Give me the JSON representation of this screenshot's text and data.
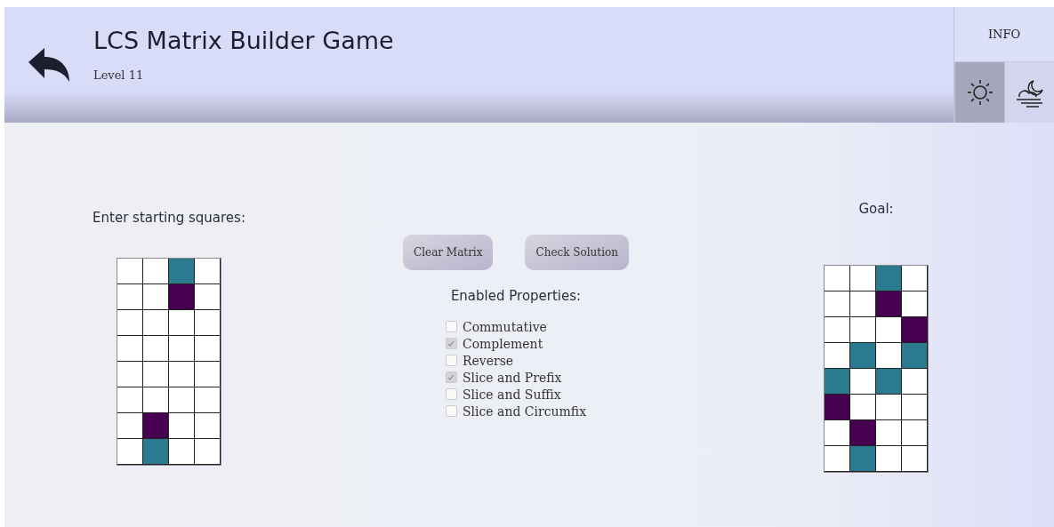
{
  "header": {
    "title": "LCS Matrix Builder Game",
    "subtitle": "Level 11",
    "info": "INFO",
    "themes": [
      {
        "kind": "light",
        "selected": true
      },
      {
        "kind": "dark",
        "selected": false
      }
    ]
  },
  "start": {
    "label": "Enter starting squares:",
    "rows": [
      [
        {
          "color": "#ffffff"
        },
        {
          "color": "#ffffff"
        },
        {
          "color": "#2b7a8f"
        },
        {
          "color": "#ffffff"
        }
      ],
      [
        {
          "color": "#ffffff"
        },
        {
          "color": "#ffffff"
        },
        {
          "color": "#45004f"
        },
        {
          "color": "#ffffff"
        }
      ],
      [
        {
          "color": "#ffffff"
        },
        {
          "color": "#ffffff"
        },
        {
          "color": "#ffffff"
        },
        {
          "color": "#ffffff"
        }
      ],
      [
        {
          "color": "#ffffff"
        },
        {
          "color": "#ffffff"
        },
        {
          "color": "#ffffff"
        },
        {
          "color": "#ffffff"
        }
      ],
      [
        {
          "color": "#ffffff"
        },
        {
          "color": "#ffffff"
        },
        {
          "color": "#ffffff"
        },
        {
          "color": "#ffffff"
        }
      ],
      [
        {
          "color": "#ffffff"
        },
        {
          "color": "#ffffff"
        },
        {
          "color": "#ffffff"
        },
        {
          "color": "#ffffff"
        }
      ],
      [
        {
          "color": "#ffffff"
        },
        {
          "color": "#45004f"
        },
        {
          "color": "#ffffff"
        },
        {
          "color": "#ffffff"
        }
      ],
      [
        {
          "color": "#ffffff"
        },
        {
          "color": "#2b7a8f"
        },
        {
          "color": "#ffffff"
        },
        {
          "color": "#ffffff"
        }
      ]
    ]
  },
  "buttons": [
    "Clear Matrix",
    "Check Solution"
  ],
  "properties": {
    "label": "Enabled Properties:",
    "items": [
      {
        "label": "Commutative",
        "checked": false
      },
      {
        "label": "Complement",
        "checked": true
      },
      {
        "label": "Reverse",
        "checked": false
      },
      {
        "label": "Slice and Prefix",
        "checked": true
      },
      {
        "label": "Slice and Suffix",
        "checked": false
      },
      {
        "label": "Slice and Circumfix",
        "checked": false
      }
    ]
  },
  "goal": {
    "label": "Goal:",
    "rows": [
      [
        {
          "color": "#ffffff"
        },
        {
          "color": "#ffffff"
        },
        {
          "color": "#2b7a8f"
        },
        {
          "color": "#ffffff"
        }
      ],
      [
        {
          "color": "#ffffff"
        },
        {
          "color": "#ffffff"
        },
        {
          "color": "#45004f"
        },
        {
          "color": "#ffffff"
        }
      ],
      [
        {
          "color": "#ffffff"
        },
        {
          "color": "#ffffff"
        },
        {
          "color": "#ffffff"
        },
        {
          "color": "#45004f"
        }
      ],
      [
        {
          "color": "#ffffff"
        },
        {
          "color": "#2b7a8f"
        },
        {
          "color": "#ffffff"
        },
        {
          "color": "#2b7a8f"
        }
      ],
      [
        {
          "color": "#2b7a8f"
        },
        {
          "color": "#ffffff"
        },
        {
          "color": "#2b7a8f"
        },
        {
          "color": "#ffffff"
        }
      ],
      [
        {
          "color": "#45004f"
        },
        {
          "color": "#ffffff"
        },
        {
          "color": "#ffffff"
        },
        {
          "color": "#ffffff"
        }
      ],
      [
        {
          "color": "#ffffff"
        },
        {
          "color": "#45004f"
        },
        {
          "color": "#ffffff"
        },
        {
          "color": "#ffffff"
        }
      ],
      [
        {
          "color": "#ffffff"
        },
        {
          "color": "#2b7a8f"
        },
        {
          "color": "#ffffff"
        },
        {
          "color": "#ffffff"
        }
      ]
    ]
  }
}
